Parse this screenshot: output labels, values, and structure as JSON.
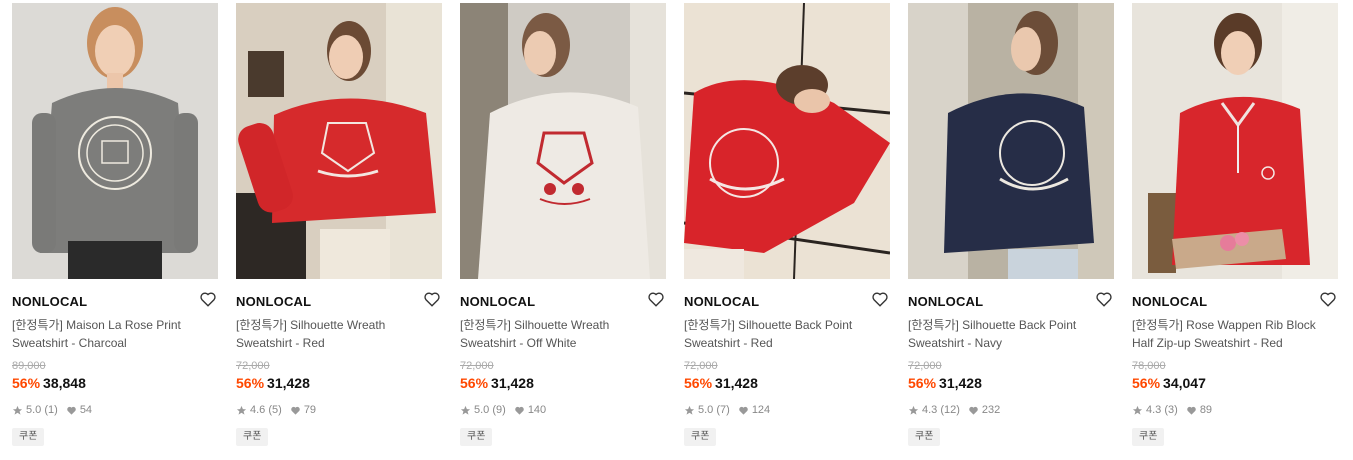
{
  "ui": {
    "coupon_label": "쿠폰",
    "accent": "#ff4800"
  },
  "products": [
    {
      "brand": "NONLOCAL",
      "title": "[한정특가] Maison La Rose Print Sweatshirt - Charcoal",
      "original_price": "89,000",
      "discount": "56%",
      "price": "38,848",
      "rating": "5.0",
      "reviews": "(1)",
      "likes": "54",
      "image": "model-charcoal-sweatshirt",
      "color": "#7d7d7b"
    },
    {
      "brand": "NONLOCAL",
      "title": "[한정특가] Silhouette Wreath Sweatshirt - Red",
      "original_price": "72,000",
      "discount": "56%",
      "price": "31,428",
      "rating": "4.6",
      "reviews": "(5)",
      "likes": "79",
      "image": "model-red-sweatshirt-kitchen",
      "color": "#d62a2c"
    },
    {
      "brand": "NONLOCAL",
      "title": "[한정특가] Silhouette Wreath Sweatshirt - Off White",
      "original_price": "72,000",
      "discount": "56%",
      "price": "31,428",
      "rating": "5.0",
      "reviews": "(9)",
      "likes": "140",
      "image": "model-offwhite-sweatshirt",
      "color": "#eeeae4"
    },
    {
      "brand": "NONLOCAL",
      "title": "[한정특가] Silhouette Back Point Sweatshirt - Red",
      "original_price": "72,000",
      "discount": "56%",
      "price": "31,428",
      "rating": "5.0",
      "reviews": "(7)",
      "likes": "124",
      "image": "model-red-sweatshirt-rug",
      "color": "#d8242a"
    },
    {
      "brand": "NONLOCAL",
      "title": "[한정특가] Silhouette Back Point Sweatshirt - Navy",
      "original_price": "72,000",
      "discount": "56%",
      "price": "31,428",
      "rating": "4.3",
      "reviews": "(12)",
      "likes": "232",
      "image": "model-navy-sweatshirt-back",
      "color": "#262d47"
    },
    {
      "brand": "NONLOCAL",
      "title": "[한정특가] Rose Wappen Rib Block Half Zip-up Sweatshirt - Red",
      "original_price": "78,000",
      "discount": "56%",
      "price": "34,047",
      "rating": "4.3",
      "reviews": "(3)",
      "likes": "89",
      "image": "model-red-halfzip",
      "color": "#d8262c"
    }
  ]
}
